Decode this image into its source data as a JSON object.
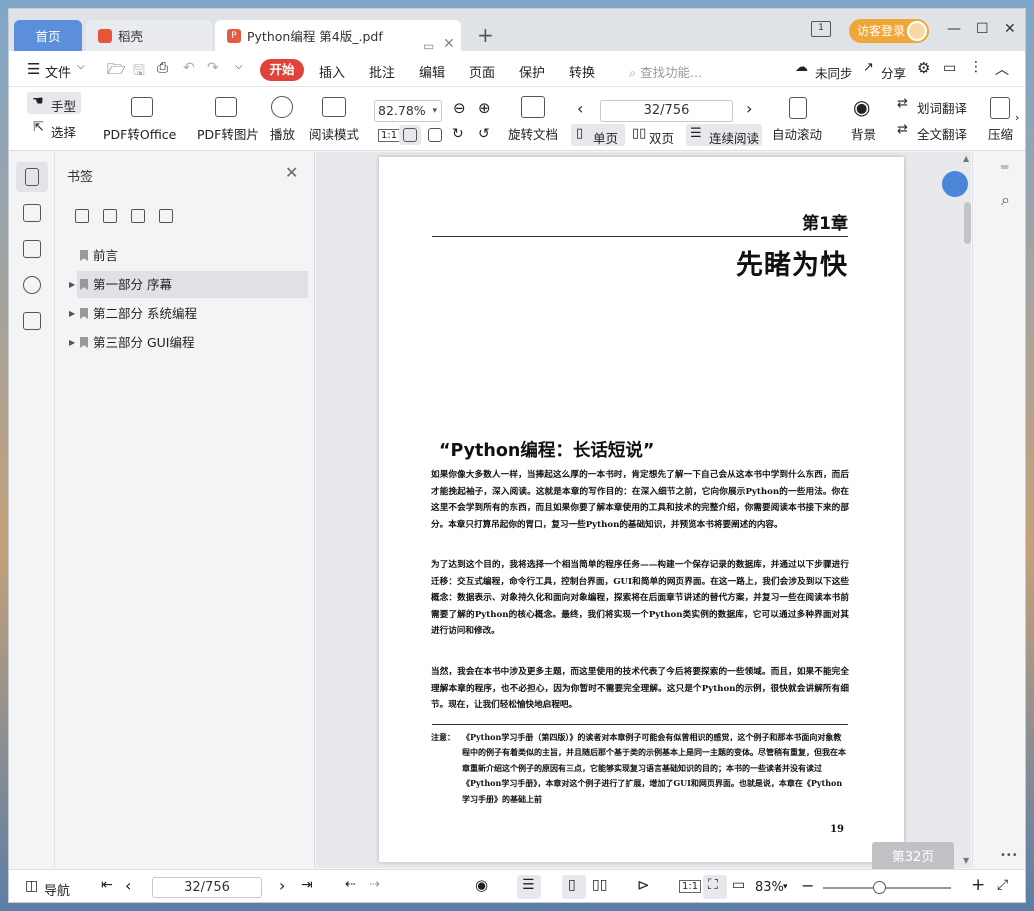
{
  "tabs": {
    "home": "首页",
    "daoke": "稻壳",
    "pdf": "Python编程 第4版_.pdf",
    "pdf_badge": "P",
    "add": "+"
  },
  "topright": {
    "login": "访客登录",
    "min": "—",
    "max": "☐",
    "close": "✕",
    "page_icon": "1"
  },
  "menu": {
    "hamburger": "☰",
    "file": "文件",
    "start": "开始",
    "items": [
      "插入",
      "批注",
      "编辑",
      "页面",
      "保护",
      "转换"
    ],
    "search_placeholder": "查找功能...",
    "sync": "未同步",
    "share": "分享"
  },
  "toolbar": {
    "hand": "手型",
    "select": "选择",
    "pdf_to_office": "PDF转Office",
    "pdf_to_image": "PDF转图片",
    "play": "播放",
    "read_mode": "阅读模式",
    "zoom": "82.78%",
    "rotate": "旋转文档",
    "page": "32/756",
    "single": "单页",
    "double": "双页",
    "continuous": "连续阅读",
    "auto_scroll": "自动滚动",
    "background": "背景",
    "word_translate": "划词翻译",
    "full_translate": "全文翻译",
    "compress": "压缩",
    "one_to_one": "1:1"
  },
  "bookmarks": {
    "title": "书签",
    "items": [
      {
        "label": "前言"
      },
      {
        "label": "第一部分  序幕"
      },
      {
        "label": "第二部分  系统编程"
      },
      {
        "label": "第三部分  GUI编程"
      }
    ]
  },
  "page": {
    "chapter": "第1章",
    "title": "先睹为快",
    "section": "“Python编程：长话短说”",
    "p1": "如果你像大多数人一样，当捧起这么厚的一本书时，肯定想先了解一下自己会从这本书中学到什么东西，而后才能挽起袖子，深入阅读。这就是本章的写作目的：在深入细节之前，它向你展示Python的一些用法。你在这里不会学到所有的东西，而且如果你要了解本章使用的工具和技术的完整介绍，你需要阅读本书接下来的部分。本章只打算吊起你的胃口，复习一些Python的基础知识，并预览本书将要阐述的内容。",
    "p2": "为了达到这个目的，我将选择一个相当简单的程序任务——构建一个保存记录的数据库，并通过以下步骤进行迁移：交互式编程，命令行工具，控制台界面，GUI和简单的网页界面。在这一路上，我们会涉及到以下这些概念：数据表示、对象持久化和面向对象编程，探索将在后面章节讲述的替代方案，并复习一些在阅读本书前需要了解的Python的核心概念。最终，我们将实现一个Python类实例的数据库，它可以通过多种界面对其进行访问和修改。",
    "p3": "当然，我会在本书中涉及更多主题，而这里使用的技术代表了今后将要探索的一些领域。而且，如果不能完全理解本章的程序，也不必担心，因为你暂时不需要完全理解。这只是个Python的示例，很快就会讲解所有细节。现在，让我们轻松愉快地启程吧。",
    "note_label": "注意：",
    "note": "《Python学习手册（第四版）》的读者对本章例子可能会有似曾相识的感觉，这个例子和那本书面向对象教程中的例子有着类似的主旨，并且随后那个基于类的示例基本上是同一主题的变体。尽管稍有重复，但我在本章重新介绍这个例子的原因有三点，它能够实现复习语言基础知识的目的；本书的一些读者并没有读过《Python学习手册》，本章对这个例子进行了扩展，增加了GUI和网页界面。也就是说，本章在《Python学习手册》的基础上前",
    "number": "19",
    "badge": "第32页"
  },
  "status": {
    "nav": "导航",
    "page": "32/756",
    "zoom": "83%",
    "one_to_one": "1:1",
    "minus": "−",
    "plus": "+",
    "more": "•••"
  }
}
